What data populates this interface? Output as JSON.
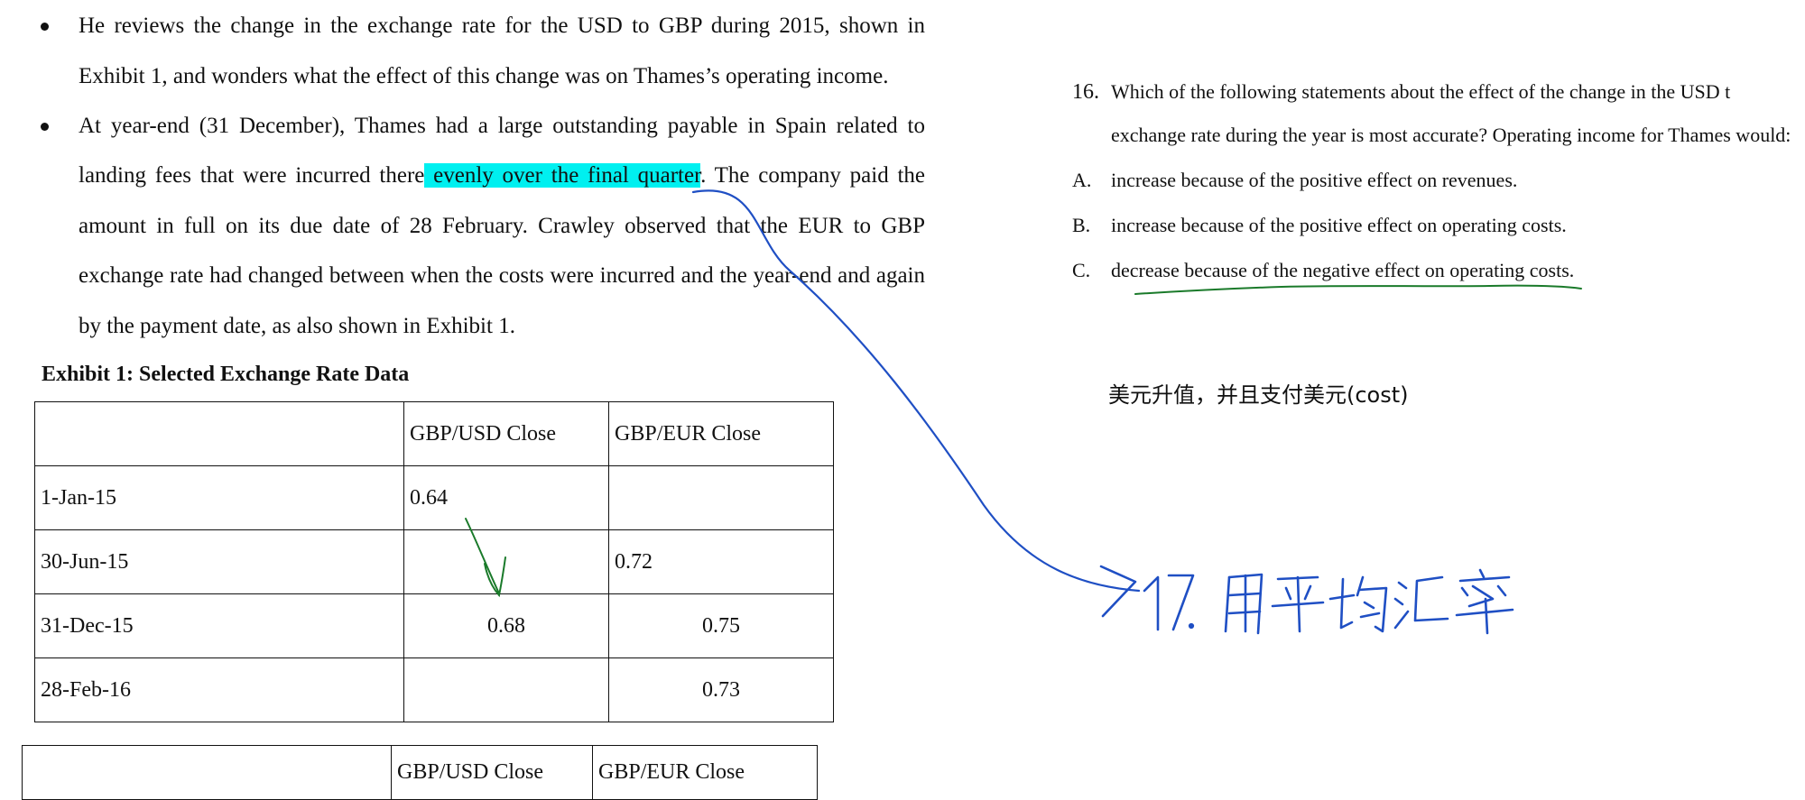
{
  "bullets": [
    {
      "lines": [
        "He reviews the change in the exchange rate for the USD to GBP during 2015, shown in",
        "Exhibit 1, and wonders what the effect of this change was on Thames’s operating income."
      ]
    },
    {
      "line1": "At year-end (31 December), Thames had a large outstanding payable in Spain related to",
      "line2_pre": "landing fees that were incurred there",
      "line2_highlight": " evenly over the final quarter",
      "line2_post": ". The company paid the",
      "line3": "amount in full on its due date of 28 February. Crawley observed that the EUR to GBP",
      "line4": "exchange rate had changed between when the costs were incurred and the year-end and again",
      "line5": "by the payment date, as also shown in Exhibit 1."
    }
  ],
  "exhibit": {
    "title": "Exhibit 1: Selected Exchange Rate Data",
    "columns": [
      "",
      "GBP/USD Close",
      "GBP/EUR Close"
    ],
    "rows": [
      [
        "1-Jan-15",
        "0.64",
        ""
      ],
      [
        "30-Jun-15",
        "",
        "0.72"
      ],
      [
        "31-Dec-15",
        "0.68",
        "0.75"
      ],
      [
        "28-Feb-16",
        "",
        "0.73"
      ]
    ],
    "repeat_columns": [
      "",
      "GBP/USD Close",
      "GBP/EUR Close"
    ]
  },
  "question": {
    "number": "16.",
    "line1": "Which of the following statements about the effect of the change in the USD t",
    "line2": "exchange rate during the year is most accurate? Operating income for Thames would:",
    "options": [
      {
        "letter": "A.",
        "text": "increase because of the positive effect on revenues."
      },
      {
        "letter": "B.",
        "text": "increase because of the positive effect on operating costs."
      },
      {
        "letter": "C.",
        "text": "decrease because of the negative effect on operating costs."
      }
    ]
  },
  "annotations": {
    "note_cn": "美元升值，并且支付美元(cost)",
    "handwritten_note": "→17. 用平均汇率",
    "ink_colors": {
      "blue": "#1f4fc4",
      "green": "#1a7a2a",
      "highlight": "#00f0f0"
    }
  }
}
